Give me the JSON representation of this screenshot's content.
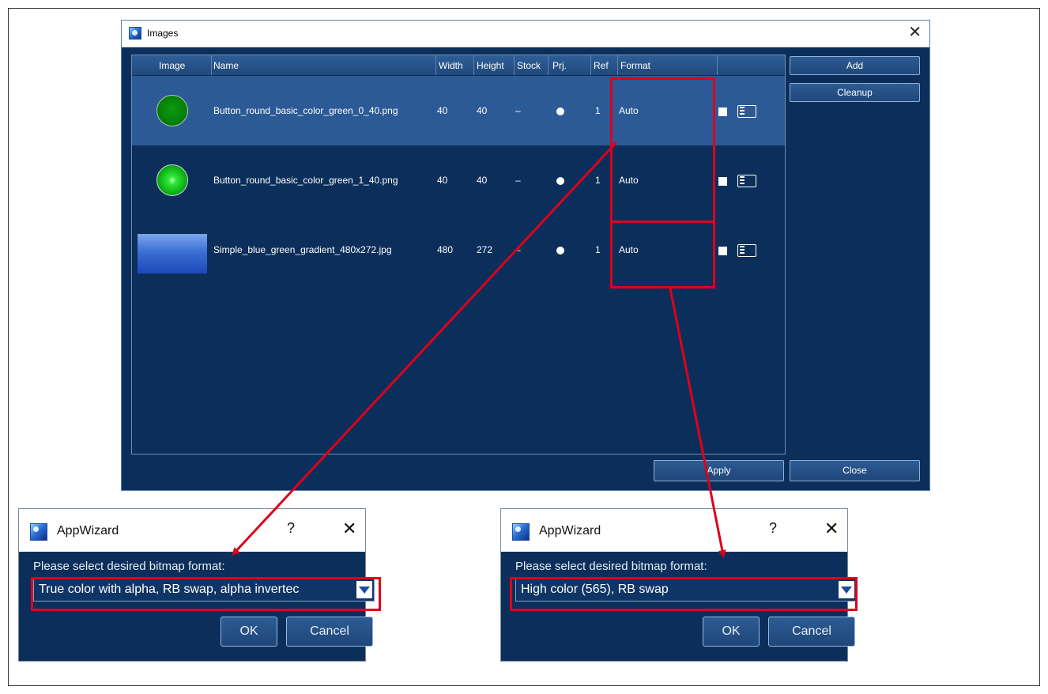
{
  "images_window": {
    "title": "Images",
    "close_glyph": "✕",
    "columns": [
      "Image",
      "Name",
      "Width",
      "Height",
      "Stock",
      "Prj.",
      "Ref",
      "Format"
    ],
    "rows": [
      {
        "name": "Button_round_basic_color_green_0_40.png",
        "width": "40",
        "height": "40",
        "stock": "–",
        "ref": "1",
        "format": "Auto",
        "thumb": "dark-green-circle",
        "selected": true
      },
      {
        "name": "Button_round_basic_color_green_1_40.png",
        "width": "40",
        "height": "40",
        "stock": "–",
        "ref": "1",
        "format": "Auto",
        "thumb": "bright-green-circle",
        "selected": false
      },
      {
        "name": "Simple_blue_green_gradient_480x272.jpg",
        "width": "480",
        "height": "272",
        "stock": "–",
        "ref": "1",
        "format": "Auto",
        "thumb": "blue-gradient",
        "selected": false
      }
    ],
    "buttons": {
      "add": "Add",
      "cleanup": "Cleanup",
      "apply": "Apply",
      "close": "Close"
    }
  },
  "dialog_left": {
    "title": "AppWizard",
    "help_glyph": "?",
    "close_glyph": "✕",
    "prompt": "Please select desired bitmap format:",
    "selected_format": "True color with alpha, RB swap, alpha invertec",
    "ok": "OK",
    "cancel": "Cancel"
  },
  "dialog_right": {
    "title": "AppWizard",
    "help_glyph": "?",
    "close_glyph": "✕",
    "prompt": "Please select desired bitmap format:",
    "selected_format": "High color (565), RB swap",
    "ok": "OK",
    "cancel": "Cancel"
  },
  "colors": {
    "window_bg": "#0b2f5a",
    "selected_row": "#2c5a96",
    "highlight": "#e0001a"
  }
}
